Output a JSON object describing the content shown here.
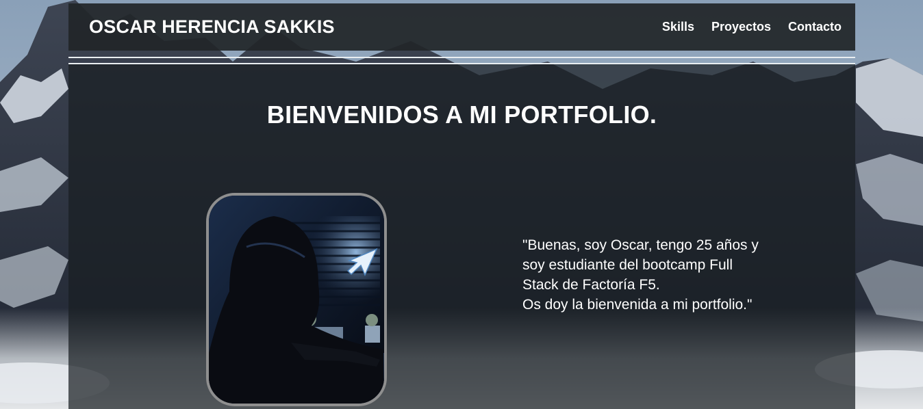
{
  "header": {
    "brand": "OSCAR HERENCIA SAKKIS",
    "nav": [
      {
        "label": "Skills"
      },
      {
        "label": "Proyectos"
      },
      {
        "label": "Contacto"
      }
    ]
  },
  "main": {
    "title": "BIENVENIDOS A MI PORTFOLIO.",
    "intro": {
      "line1": "\"Buenas, soy Oscar, tengo 25 años y soy estudiante del bootcamp Full Stack de Factoría F5.",
      "line2": "Os doy la bienvenida a mi portfolio.\""
    }
  },
  "colors": {
    "navbar_bg": "#212629",
    "text": "#ffffff",
    "avatar_border": "#8f8f8f"
  }
}
